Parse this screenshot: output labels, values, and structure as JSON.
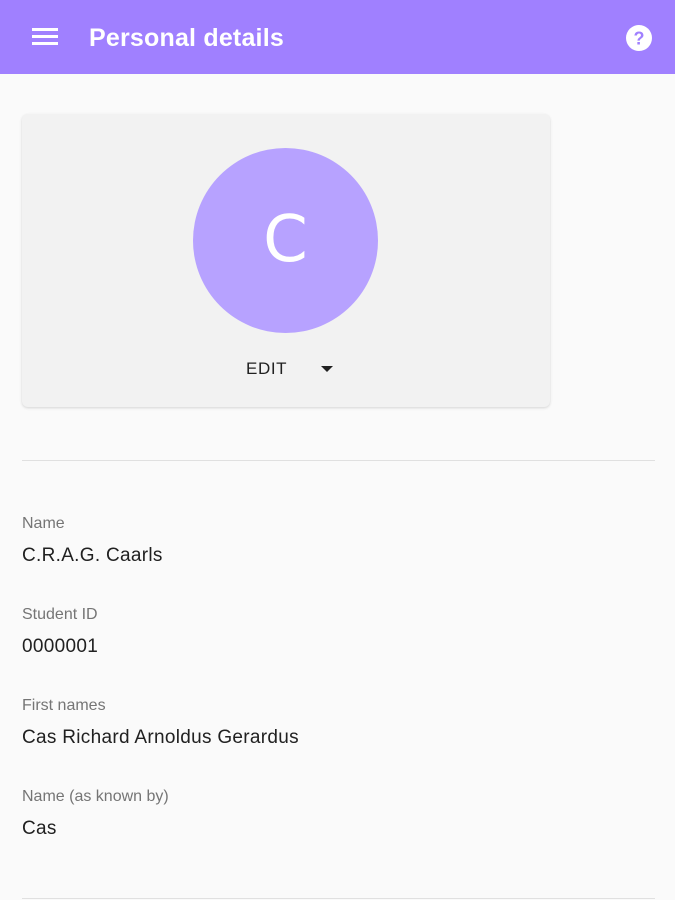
{
  "header": {
    "title": "Personal details",
    "menu_icon": "menu-icon",
    "help_icon": "help-icon",
    "help_glyph": "?"
  },
  "avatar": {
    "initial": "C",
    "edit_label": "EDIT",
    "dropdown_icon": "chevron-down-icon"
  },
  "fields": [
    {
      "label": "Name",
      "value": "C.R.A.G. Caarls"
    },
    {
      "label": "Student ID",
      "value": "0000001"
    },
    {
      "label": "First names",
      "value": "Cas Richard Arnoldus Gerardus"
    },
    {
      "label": "Name (as known by)",
      "value": "Cas"
    }
  ],
  "colors": {
    "app_bar": "#a080ff",
    "avatar": "#b7a2ff",
    "background": "#fafafa",
    "card": "#f2f2f2"
  }
}
